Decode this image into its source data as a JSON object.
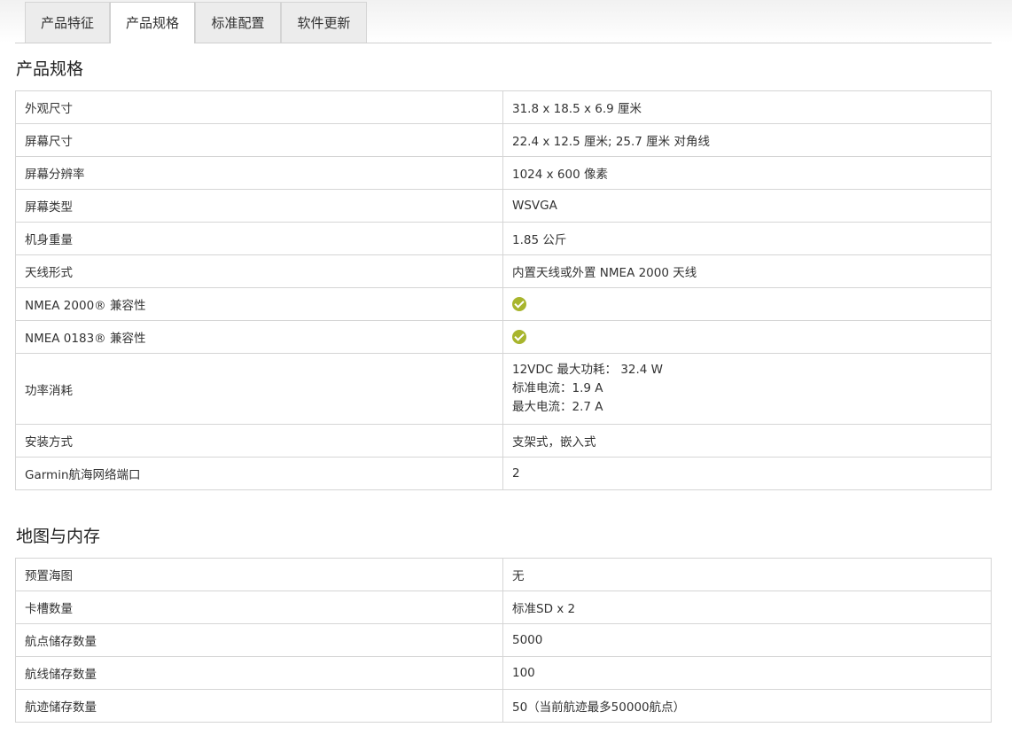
{
  "tabs": [
    {
      "label": "产品特征",
      "active": false
    },
    {
      "label": "产品规格",
      "active": true
    },
    {
      "label": "标准配置",
      "active": false
    },
    {
      "label": "软件更新",
      "active": false
    }
  ],
  "specs": {
    "title": "产品规格",
    "rows": [
      {
        "label": "外观尺寸",
        "value": "31.8 x 18.5 x 6.9 厘米"
      },
      {
        "label": "屏幕尺寸",
        "value": "22.4 x 12.5 厘米; 25.7 厘米 对角线"
      },
      {
        "label": "屏幕分辨率",
        "value": "1024 x 600 像素"
      },
      {
        "label": "屏幕类型",
        "value": "WSVGA"
      },
      {
        "label": "机身重量",
        "value": "1.85 公斤"
      },
      {
        "label": "天线形式",
        "value": "内置天线或外置 NMEA 2000 天线"
      },
      {
        "label": "NMEA 2000® 兼容性",
        "icon": "check-circle-icon"
      },
      {
        "label": "NMEA 0183® 兼容性",
        "icon": "check-circle-icon"
      },
      {
        "label": "功率消耗",
        "lines": [
          "12VDC 最大功耗： 32.4 W",
          "标准电流：1.9 A",
          "最大电流：2.7 A"
        ]
      },
      {
        "label": "安装方式",
        "value": "支架式，嵌入式"
      },
      {
        "label": "Garmin航海网络端口",
        "value": "2"
      }
    ]
  },
  "maps": {
    "title": "地图与内存",
    "rows": [
      {
        "label": "预置海图",
        "value": "无"
      },
      {
        "label": "卡槽数量",
        "value": "标准SD x 2"
      },
      {
        "label": "航点储存数量",
        "value": "5000"
      },
      {
        "label": "航线储存数量",
        "value": "100"
      },
      {
        "label": "航迹储存数量",
        "value": "50（当前航迹最多50000航点）"
      }
    ]
  },
  "colors": {
    "check_icon": "#a8b52d",
    "border": "#d5d5d5"
  }
}
